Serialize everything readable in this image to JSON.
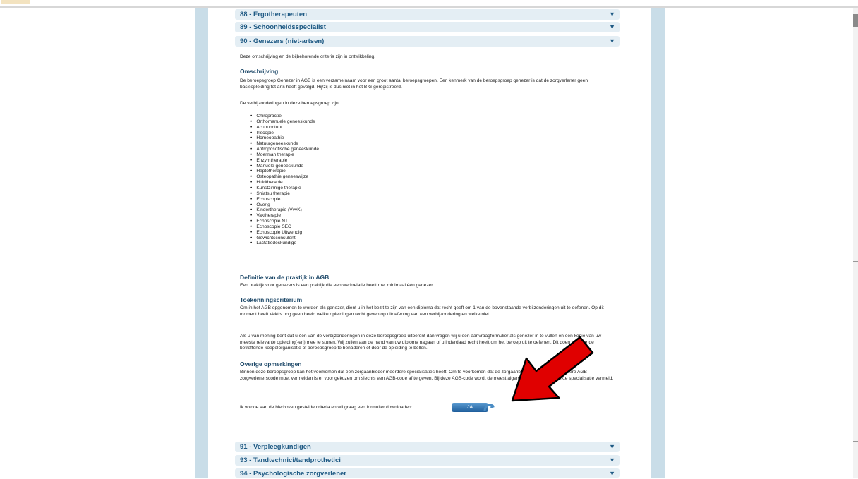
{
  "accordion_top": [
    {
      "label": "88 - Ergotherapeuten"
    },
    {
      "label": "89 - Schoonheidsspecialist"
    },
    {
      "label": "90 - Genezers (niet-artsen)"
    }
  ],
  "accordion_bottom": [
    {
      "label": "91 - Verpleegkundigen"
    },
    {
      "label": "93 - Tandtechnici/tandprothetici"
    },
    {
      "label": "94 - Psychologische zorgverlener"
    }
  ],
  "arrow_glyph": "▼",
  "intro": "Deze omschrijving en de bijbehorende criteria zijn in ontwikkeling.",
  "omschrijving": {
    "heading": "Omschrijving",
    "text": "De beroepsgroep Genezer in AGB is een verzamelnaam voor een groot aantal beroepsgroepen. Een kenmerk van de beroepsgroep genezer is dat de zorgverlener geen basisopleiding tot arts heeft gevolgd. Hij/zij is dus niet in het BIG geregistreerd.",
    "list_intro": "De verbijzonderingen in deze beroepsgroep zijn:",
    "items": [
      "Chiropractie",
      "Orthomanuele geneeskunde",
      "Acupunctuur",
      "Iriscopie",
      "Homeopathie",
      "Natuurgeneeskunde",
      "Antroposofische geneeskunde",
      "Moerman therapie",
      "Enzymtherapie",
      "Manuele geneeskunde",
      "Haptotherapie",
      "Osteopathie geneeswijze",
      "Huidtherapie",
      "Kunstzinnige therapie",
      "Shiatsu therapie",
      "Echoscopie",
      "Overig",
      "Kindertherapie (VvvK)",
      "Vaktherapie",
      "Echoscopie NT",
      "Echoscopie SEO",
      "Echoscopie Uitwendig",
      "Gewichtsconsulent",
      "Lactatiedeskundige"
    ]
  },
  "definitie": {
    "heading": "Definitie van de praktijk in AGB",
    "text": "Een praktijk voor genezers is een praktijk die een werkrelatie heeft met minimaal één genezer."
  },
  "toekenning": {
    "heading": "Toekenningscriterium",
    "text1": "Om in het AGB opgenomen te worden als genezer, dient u in het bezit te zijn van een diploma dat recht geeft om 1 van de bovenstaande verbijzonderingen uit te oefenen. Op dit moment heeft Vektis nog geen beeld welke opleidingen recht geven op uitoefening van een verbijzondering en welke niet.",
    "text2": "Als u van mening bent dat u één van de verbijzonderingen in deze beroepsgroep uitoefent dan vragen wij u een aanvraagformulier als genezer in te vullen en een kopie van uw meeste relevante opleiding(-en) mee te sturen. Wij zullen aan de hand van uw diploma nagaan of u inderdaad recht heeft om het beroep uit te oefenen. Dit doen wij door de betreffende koepelorganisatie of beroepsgroep te benaderen of door de opleiding te bellen."
  },
  "overige": {
    "heading": "Overige opmerkingen",
    "text": "Binnen deze beroepsgroep kan het voorkomen dat een zorgaanbieder meerdere specialisaties heeft. Om te voorkomen dat de zorgaanbieder voor elke een andere AGB-zorgverlenerscode moet vermelden is er voor gekozen om slechts een AGB-code af te geven. Bij deze AGB-code wordt de meest algemene of meest gebruikte specialisatie vermeld."
  },
  "download": {
    "prompt": "Ik voldoe aan de hierboven gestelde criteria en wil graag een formulier downloaden:",
    "button_label": "JA"
  },
  "colors": {
    "accordion_bg": "#e4eef4",
    "accordion_text": "#1f5a84",
    "side_panel": "#c9dde8",
    "annotation_arrow": "#e00000"
  }
}
